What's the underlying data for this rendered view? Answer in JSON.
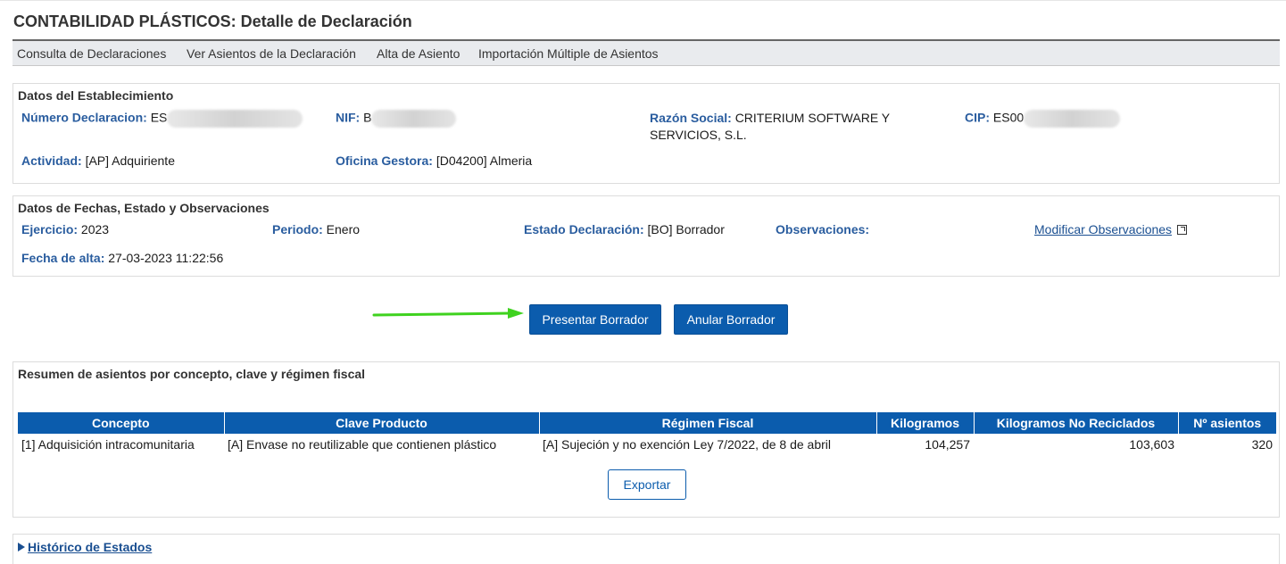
{
  "page": {
    "title": "CONTABILIDAD PLÁSTICOS: Detalle de Declaración"
  },
  "nav": {
    "items": [
      {
        "label": "Consulta de Declaraciones"
      },
      {
        "label": "Ver Asientos de la Declaración"
      },
      {
        "label": "Alta de Asiento"
      },
      {
        "label": "Importación Múltiple de Asientos"
      }
    ]
  },
  "establecimiento": {
    "title": "Datos del Establecimiento",
    "numero_declaracion": {
      "label": "Número Declaracion:",
      "value": "ES"
    },
    "nif": {
      "label": "NIF:",
      "value": "B"
    },
    "razon_social": {
      "label": "Razón Social:",
      "value_line1": "CRITERIUM SOFTWARE Y",
      "value_line2": "SERVICIOS, S.L."
    },
    "cip": {
      "label": "CIP:",
      "value": "ES00"
    },
    "actividad": {
      "label": "Actividad:",
      "value": "[AP] Adquiriente"
    },
    "oficina_gestora": {
      "label": "Oficina Gestora:",
      "value": "[D04200] Almeria"
    }
  },
  "fechas": {
    "title": "Datos de Fechas, Estado y Observaciones",
    "ejercicio": {
      "label": "Ejercicio:",
      "value": "2023"
    },
    "periodo": {
      "label": "Periodo:",
      "value": "Enero"
    },
    "estado": {
      "label": "Estado Declaración:",
      "value": "[BO] Borrador"
    },
    "observaciones": {
      "label": "Observaciones:",
      "value": ""
    },
    "modificar_link": "Modificar Observaciones",
    "fecha_alta": {
      "label": "Fecha de alta:",
      "value": "27-03-2023 11:22:56"
    }
  },
  "actions": {
    "presentar": "Presentar Borrador",
    "anular": "Anular Borrador"
  },
  "resumen": {
    "title": "Resumen de asientos por concepto, clave y régimen fiscal",
    "headers": [
      "Concepto",
      "Clave Producto",
      "Régimen Fiscal",
      "Kilogramos",
      "Kilogramos No Reciclados",
      "Nº asientos"
    ],
    "rows": [
      [
        "[1] Adquisición intracomunitaria",
        "[A] Envase no reutilizable que contienen plástico",
        "[A] Sujeción y no exención Ley 7/2022, de 8 de abril",
        "104,257",
        "103,603",
        "320"
      ]
    ],
    "export_label": "Exportar"
  },
  "historico": {
    "label": "Histórico de Estados"
  },
  "colors": {
    "primary": "#0b5cad",
    "label_blue": "#2a5d9f",
    "arrow_green": "#3fd21f"
  },
  "icons": [
    "external-link-icon",
    "expand-triangle-icon",
    "annotation-arrow"
  ]
}
